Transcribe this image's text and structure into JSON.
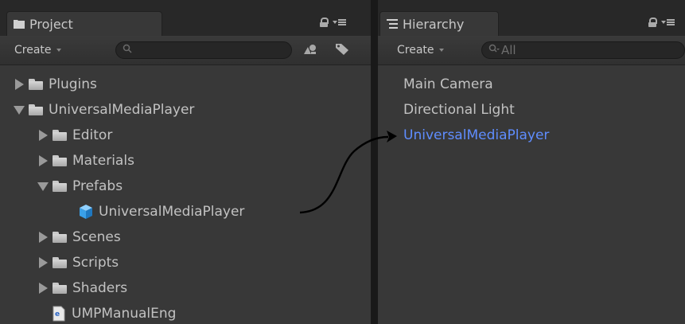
{
  "project": {
    "tab_label": "Project",
    "create_label": "Create",
    "search_placeholder": "",
    "tree": [
      {
        "label": "Plugins"
      },
      {
        "label": "UniversalMediaPlayer"
      },
      {
        "label": "Editor"
      },
      {
        "label": "Materials"
      },
      {
        "label": "Prefabs"
      },
      {
        "label": "UniversalMediaPlayer"
      },
      {
        "label": "Scenes"
      },
      {
        "label": "Scripts"
      },
      {
        "label": "Shaders"
      },
      {
        "label": "UMPManualEng"
      }
    ]
  },
  "hierarchy": {
    "tab_label": "Hierarchy",
    "create_label": "Create",
    "search_placeholder": "All",
    "items": [
      {
        "label": "Main Camera"
      },
      {
        "label": "Directional Light"
      },
      {
        "label": "UniversalMediaPlayer",
        "selected": true
      }
    ]
  },
  "colors": {
    "panel_bg": "#383838",
    "tab_bar_bg": "#282828",
    "text": "#c2c2c2",
    "selected_text": "#5f8dff",
    "cube_icon": "#3aa0e8"
  }
}
